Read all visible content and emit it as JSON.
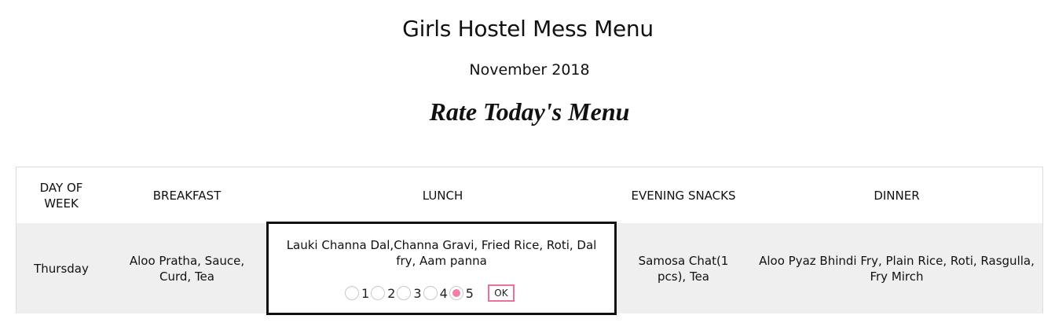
{
  "page": {
    "title": "Girls Hostel Mess Menu",
    "subtitle": "November 2018",
    "rate_heading": "Rate Today's Menu"
  },
  "table": {
    "headers": {
      "day": "DAY OF WEEK",
      "breakfast": "BREAKFAST",
      "lunch": "LUNCH",
      "snacks": "EVENING SNACKS",
      "dinner": "DINNER"
    },
    "row": {
      "day": "Thursday",
      "breakfast": "Aloo Pratha, Sauce, Curd, Tea",
      "lunch": "Lauki Channa Dal,Channa Gravi, Fried Rice, Roti, Dal fry, Aam panna",
      "snacks": "Samosa Chat(1 pcs), Tea",
      "dinner": "Aloo Pyaz Bhindi Fry, Plain Rice, Roti, Rasgulla, Fry Mirch"
    }
  },
  "rating": {
    "options": [
      "1",
      "2",
      "3",
      "4",
      "5"
    ],
    "selected": "5",
    "ok_label": "OK",
    "accent_color": "#f27fa4"
  }
}
